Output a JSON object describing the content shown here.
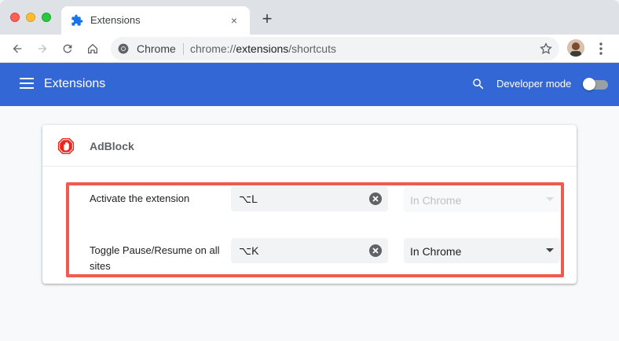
{
  "browser": {
    "tab_title": "Extensions",
    "tab_close": "×",
    "new_tab": "+",
    "omnibox_label": "Chrome",
    "url_scheme": "chrome://",
    "url_host": "extensions",
    "url_path": "/shortcuts"
  },
  "header": {
    "title": "Extensions",
    "developer_mode_label": "Developer mode",
    "developer_mode_on": false
  },
  "extension": {
    "name": "AdBlock",
    "shortcuts": [
      {
        "label": "Activate the extension",
        "key": "⌥L",
        "scope": "In Chrome",
        "scope_enabled": false
      },
      {
        "label": "Toggle Pause/Resume on all sites",
        "key": "⌥K",
        "scope": "In Chrome",
        "scope_enabled": true
      }
    ]
  },
  "colors": {
    "header_bg": "#3367d6",
    "highlight": "#f05a4f",
    "adblock_red": "#e8261e"
  }
}
